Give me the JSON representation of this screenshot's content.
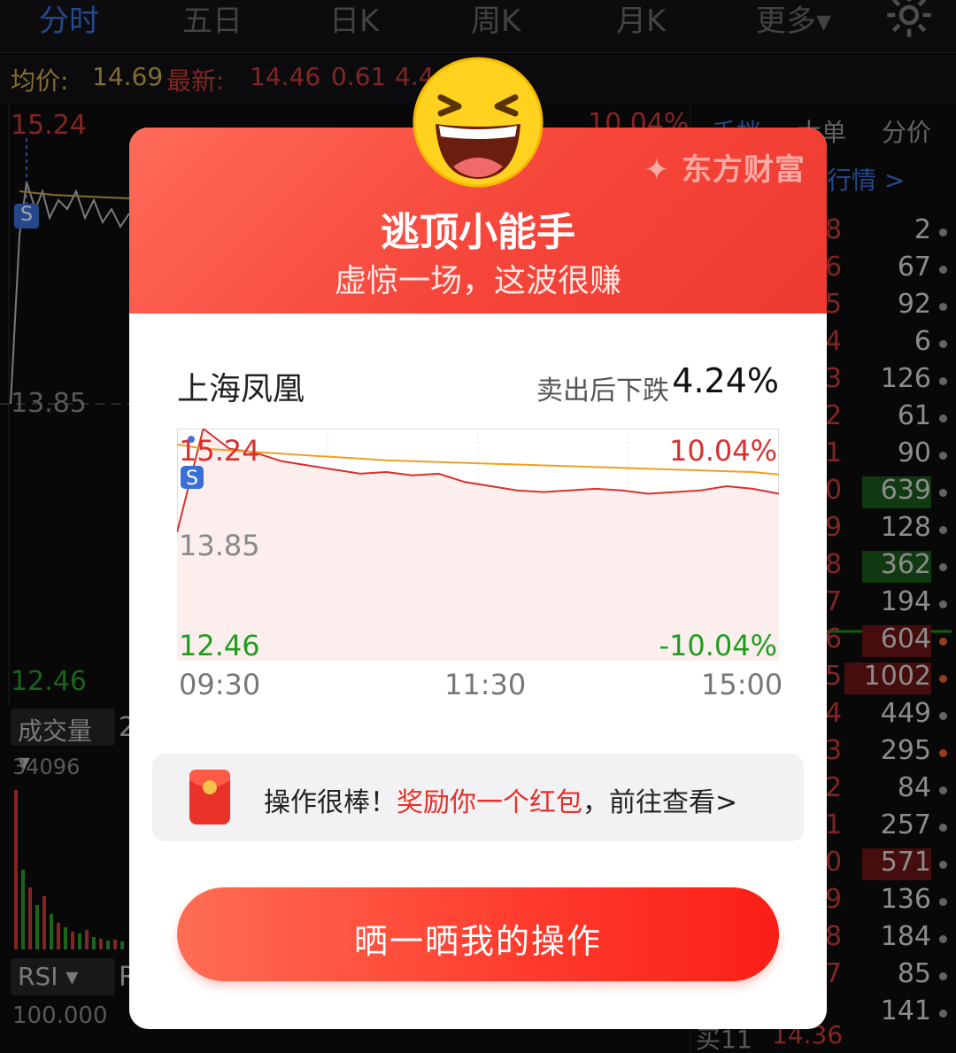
{
  "tabs": [
    "分时",
    "五日",
    "日K",
    "周K",
    "月K",
    "更多▾"
  ],
  "info": {
    "avg_label": "均价:",
    "avg": "14.69",
    "latest_label": "最新:",
    "latest": "14.46",
    "change": "0.61",
    "pct": "4.4"
  },
  "bg_axes": {
    "top": "15.24",
    "mid": "13.85",
    "low": "12.46",
    "pct_top": "10.04%",
    "vol_label": "成交量",
    "vol_suffix": "2",
    "vol_max": "34096",
    "rsi_label": "RSI",
    "rsi_suffix": "R",
    "rsi_max": "100.000"
  },
  "side": {
    "tabs": [
      "千档",
      "大单",
      "分价"
    ],
    "link": "行情 >",
    "rows": [
      "2",
      "67",
      "92",
      "6",
      "126",
      "61",
      "90",
      "639",
      "128",
      "362",
      "194",
      "604",
      "1002",
      "449",
      "295",
      "84",
      "257",
      "571",
      "136",
      "184",
      "85",
      "141"
    ],
    "left_digits": [
      "8",
      "6",
      "5",
      "4",
      "3",
      "2",
      "1",
      "0",
      "9",
      "8",
      "7",
      "6",
      "5",
      "4",
      "3",
      "2",
      "1",
      "0",
      "9",
      "8",
      "7"
    ],
    "bottom_left": "买11",
    "bottom_price": "14.36"
  },
  "modal": {
    "brand": "东方财富",
    "title": "逃顶小能手",
    "subtitle": "虚惊一场，这波很赚",
    "stock_name": "上海凤凰",
    "drop_label": "卖出后下跌",
    "drop_value": "4.24%",
    "reward_prefix": "操作很棒！",
    "reward_highlight": "奖励你一个红包",
    "reward_suffix": "，前往查看>",
    "cta": "晒一晒我的操作"
  },
  "chart_data": {
    "type": "line",
    "x": [
      "09:30",
      "11:30",
      "15:00"
    ],
    "y_ticks": [
      "15.24",
      "13.85",
      "12.46"
    ],
    "pct_ticks": [
      "10.04%",
      "-10.04%"
    ],
    "ylim": [
      12.46,
      15.24
    ],
    "prev_close": 13.85,
    "series": [
      {
        "values": [
          14.0,
          15.24,
          15.0,
          14.95,
          14.85,
          14.8,
          14.75,
          14.7,
          14.72,
          14.68,
          14.7,
          14.6,
          14.55,
          14.5,
          14.48,
          14.5,
          14.52,
          14.5,
          14.46,
          14.48,
          14.5,
          14.55,
          14.52,
          14.46
        ]
      },
      {
        "values": [
          15.05,
          15.0,
          14.98,
          14.96,
          14.94,
          14.92,
          14.9,
          14.88,
          14.86,
          14.85,
          14.84,
          14.83,
          14.82,
          14.81,
          14.8,
          14.79,
          14.78,
          14.77,
          14.76,
          14.75,
          14.74,
          14.73,
          14.72,
          14.69
        ]
      }
    ],
    "colors": {
      "price": "#d9302c",
      "avg": "#f0a020",
      "up": "#d9302c",
      "down": "#1e9e1e"
    }
  }
}
